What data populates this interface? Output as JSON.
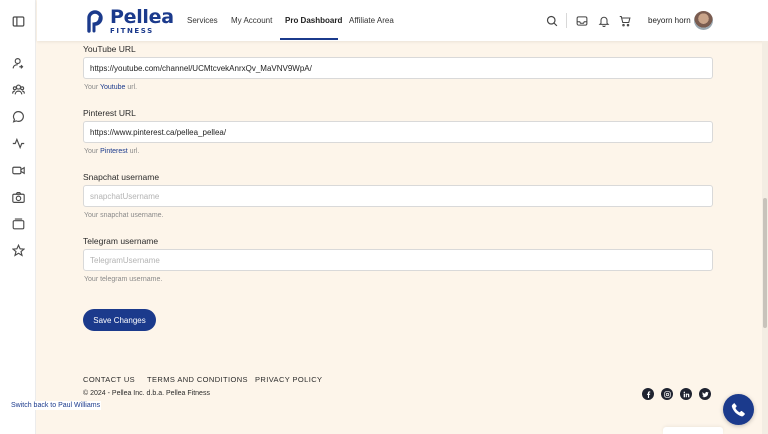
{
  "header": {
    "logo": {
      "name": "Pellea",
      "sub": "FITNESS"
    },
    "nav": [
      {
        "label": "Services"
      },
      {
        "label": "My Account"
      },
      {
        "label": "Pro Dashboard",
        "active": true
      },
      {
        "label": "Affiliate Area"
      }
    ],
    "icons": [
      "search-icon",
      "inbox-icon",
      "bell-icon",
      "cart-icon"
    ],
    "username": "beyorn horn"
  },
  "sidebar": {
    "icons": [
      "sidebar-toggle-icon",
      "user-switch-icon",
      "users-icon",
      "chat-icon",
      "activity-icon",
      "video-icon",
      "camera-icon",
      "gallery-icon",
      "star-icon"
    ]
  },
  "form": {
    "youtube": {
      "label": "YouTube URL",
      "value": "https://youtube.com/channel/UCMtcvekAnrxQv_MaVNV9WpA/",
      "help_prefix": "Your ",
      "help_link": "Youtube",
      "help_suffix": " url."
    },
    "pinterest": {
      "label": "Pinterest URL",
      "value": "https://www.pinterest.ca/pellea_pellea/",
      "help_prefix": "Your ",
      "help_link": "Pinterest",
      "help_suffix": " url."
    },
    "snapchat": {
      "label": "Snapchat username",
      "value": "",
      "placeholder": "snapchatUsername",
      "help": "Your snapchat username."
    },
    "telegram": {
      "label": "Telegram username",
      "value": "",
      "placeholder": "TelegramUsername",
      "help": "Your telegram username."
    },
    "save_label": "Save Changes"
  },
  "footer": {
    "links": [
      "CONTACT US",
      "TERMS AND CONDITIONS",
      "PRIVACY POLICY"
    ],
    "copyright": "© 2024 - Pellea Inc. d.b.a. Pellea Fitness",
    "social": [
      "facebook-icon",
      "instagram-icon",
      "linkedin-icon",
      "twitter-icon"
    ]
  },
  "switch_back": "Switch back to Paul Williams",
  "colors": {
    "brand": "#1b3a8c",
    "background": "#fdf5ea",
    "social_bg": "#1f2330"
  }
}
